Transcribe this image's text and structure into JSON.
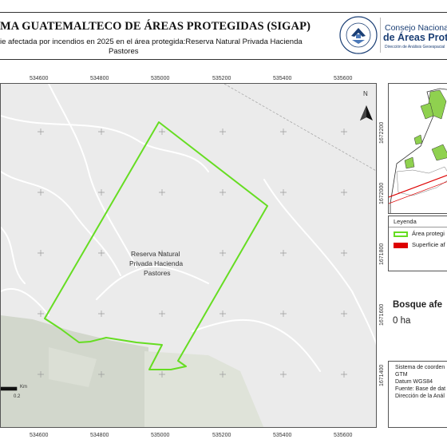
{
  "header": {
    "title": "MA GUATEMALTECO DE ÁREAS PROTEGIDAS  (SIGAP)",
    "subtitle_line1": "ie afectada por incendios en 2025 en el área protegida:Reserva Natural Privada Hacienda",
    "subtitle_line2": "Pastores",
    "seal_text_top": "CONSEJO DE LA REPÚBLICA",
    "seal_text_bottom": "GUATEMALA",
    "logo_line1": "Consejo Nacional",
    "logo_line2": "de Áreas Protegi",
    "logo_line3": "Dirección de Análisis Geoespacial"
  },
  "map": {
    "north_label": "N",
    "area_label_lines": [
      "Reserva Natural",
      "Privada Hacienda",
      "Pastores"
    ],
    "x_ticks": [
      "534600",
      "534800",
      "535000",
      "535200",
      "535400",
      "535600"
    ],
    "y_ticks": [
      "1672200",
      "1672000",
      "1671800",
      "1671600",
      "1671400"
    ],
    "scale_unit": "Km",
    "scale_value": "0.2",
    "colors": {
      "boundary": "#66dd22",
      "affected": "#dd0000",
      "background": "#ebebeb",
      "forest": "#cfd4c8"
    }
  },
  "legend": {
    "title": "Leyenda",
    "items": [
      {
        "label": "Área protegi",
        "swatch": "outline",
        "color": "#66dd22"
      },
      {
        "label": "Superficie af",
        "swatch": "fill",
        "color": "#dd0000"
      }
    ]
  },
  "stats": {
    "title": "Bosque afe",
    "value": "0 ha"
  },
  "info": {
    "lines": [
      "Sistema de coorden",
      "GTM",
      "Datum WGS84",
      "Fuente: Base de dat",
      "Dirección de la Anál"
    ]
  }
}
